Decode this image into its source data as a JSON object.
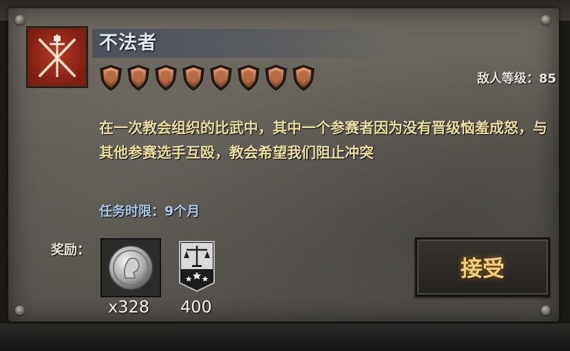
{
  "quest": {
    "title": "不法者",
    "shield_count": 8,
    "enemy_level": "敌人等级：85",
    "description": "在一次教会组织的比武中，其中一个参赛者因为没有晋级恼羞成怒，与其他参赛选手互殴，教会希望我们阻止冲突",
    "time_limit": "任务时限：9个月",
    "rewards_label": "奖励：",
    "rewards": [
      {
        "icon": "silver-coin-icon",
        "count": "x328"
      },
      {
        "icon": "justice-scale-banner-icon",
        "count": "400"
      }
    ],
    "accept_label": "接受"
  },
  "colors": {
    "title": "#dfe8f3",
    "description": "#ebdca0",
    "time_limit": "#aac6e6",
    "accept_text": "#f0d07a",
    "emblem_red": "#b33a22"
  }
}
